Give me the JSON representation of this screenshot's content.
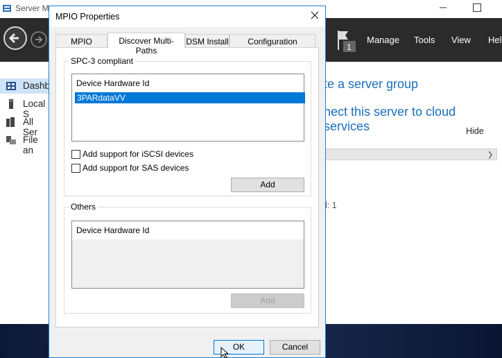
{
  "background_window": {
    "title": "Server Ma",
    "menu": [
      "Manage",
      "Tools",
      "View",
      "Help"
    ],
    "notification_count": "1",
    "sidebar": [
      {
        "label": "Dashb",
        "icon": "dashboard-icon",
        "active": true
      },
      {
        "label": "Local S",
        "icon": "server-icon",
        "active": false
      },
      {
        "label": "All Ser",
        "icon": "servers-icon",
        "active": false
      },
      {
        "label": "File an",
        "icon": "file-storage-icon",
        "active": false
      }
    ],
    "links": [
      "te a server group",
      "nect this server to cloud services"
    ],
    "hide_label": "Hide",
    "count_text": "l: 1"
  },
  "dialog": {
    "title": "MPIO Properties",
    "tabs": [
      "MPIO Devices",
      "Discover Multi-Paths",
      "DSM Install",
      "Configuration Snapshot"
    ],
    "selected_tab": "Discover Multi-Paths",
    "spc3": {
      "legend": "SPC-3 compliant",
      "list_header": "Device Hardware Id",
      "items": [
        {
          "label": "3PARdataVV",
          "selected": true
        }
      ],
      "checkboxes": [
        {
          "label": "Add support for iSCSI devices",
          "checked": false
        },
        {
          "label": "Add support for SAS devices",
          "checked": false
        }
      ],
      "add_button": "Add"
    },
    "others": {
      "legend": "Others",
      "list_header": "Device Hardware Id",
      "items": [],
      "add_button": "Add"
    },
    "ok_button": "OK",
    "cancel_button": "Cancel"
  },
  "colors": {
    "selection": "#0078d7",
    "header_bg": "#2b2b2b",
    "link": "#1a6fbd",
    "dialog_border": "#1883d7"
  }
}
